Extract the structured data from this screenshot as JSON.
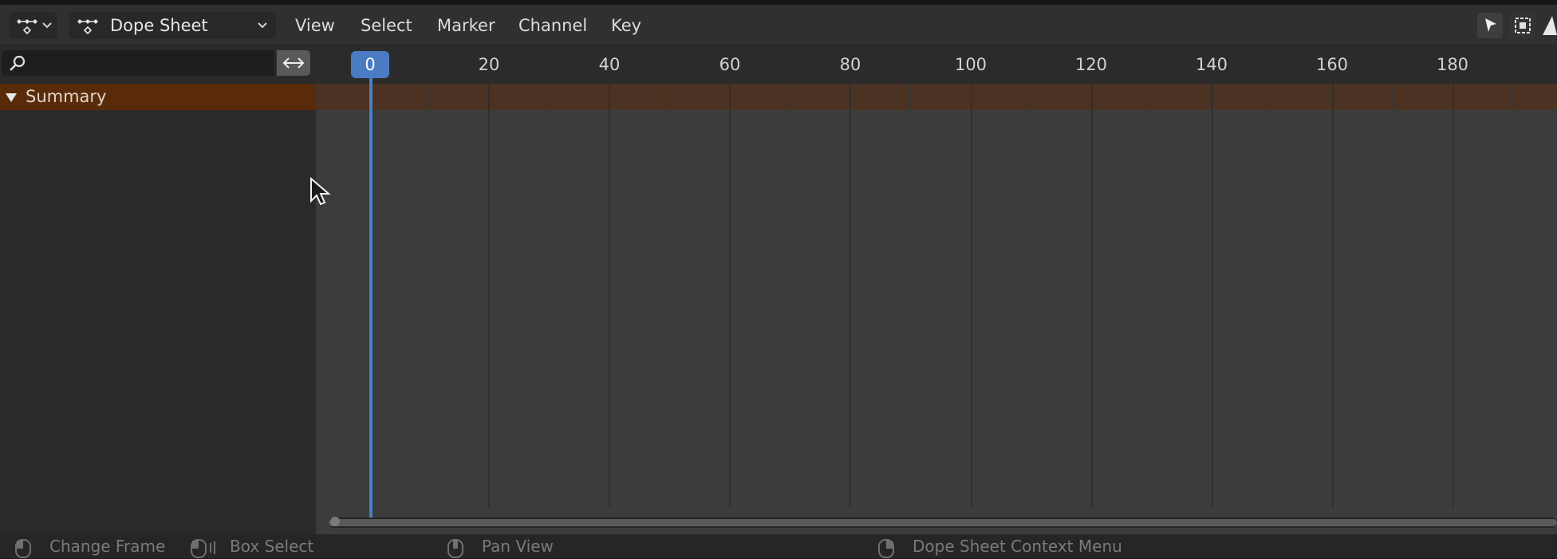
{
  "header": {
    "editor_type_icon": "dope-sheet-icon",
    "mode": "Dope Sheet",
    "menus": [
      "View",
      "Select",
      "Marker",
      "Channel",
      "Key"
    ],
    "right_tools": [
      "select-arrow-icon",
      "box-select-icon"
    ]
  },
  "channels": {
    "search_placeholder": "",
    "summary_label": "Summary"
  },
  "timeline": {
    "current_frame": "0",
    "tick_labels": [
      "20",
      "40",
      "60",
      "80",
      "100",
      "120",
      "140",
      "160",
      "180"
    ]
  },
  "status_bar": {
    "items": [
      "Change Frame",
      "Box Select",
      "Pan View",
      "Dope Sheet Context Menu"
    ]
  },
  "colors": {
    "summary_channel": "#5a2b0b",
    "playhead": "#4a7bc3"
  }
}
